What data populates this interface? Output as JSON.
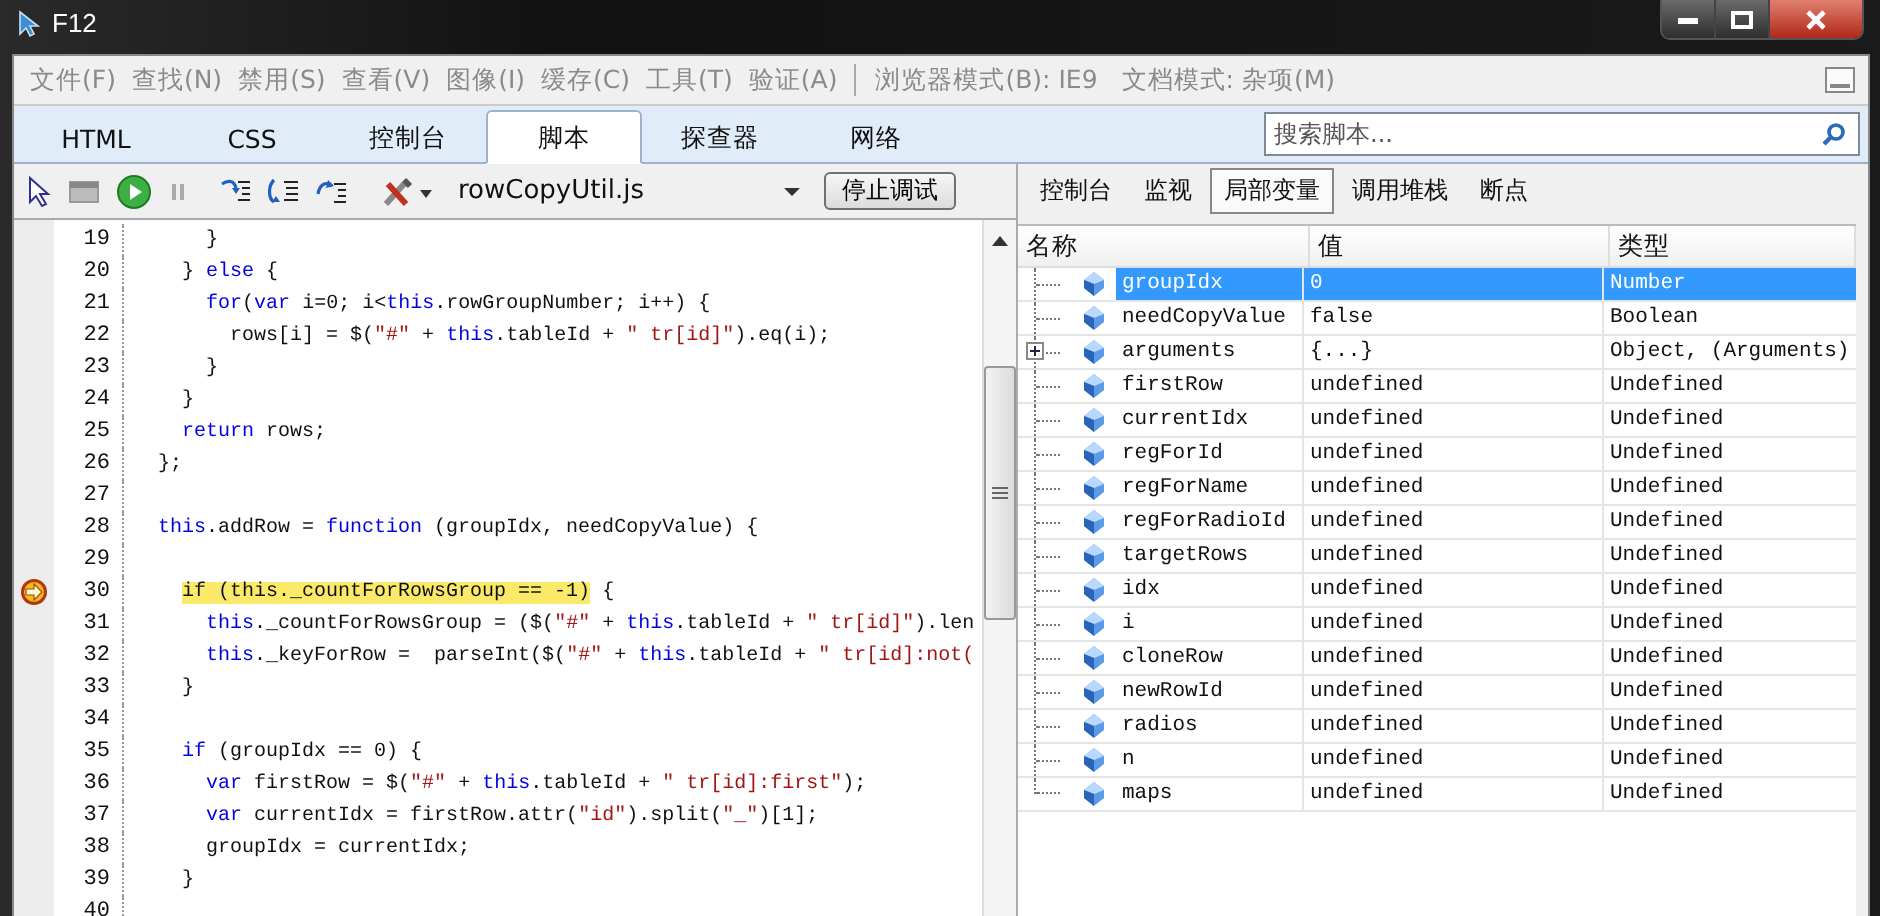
{
  "window": {
    "title": "F12"
  },
  "menu": [
    {
      "label": "文件(F)",
      "kind": "item"
    },
    {
      "label": "查找(N)",
      "kind": "item"
    },
    {
      "label": "禁用(S)",
      "kind": "item"
    },
    {
      "label": "查看(V)",
      "kind": "item"
    },
    {
      "label": "图像(I)",
      "kind": "item"
    },
    {
      "label": "缓存(C)",
      "kind": "item"
    },
    {
      "label": "工具(T)",
      "kind": "item"
    },
    {
      "label": "验证(A)",
      "kind": "item"
    },
    {
      "label": "浏览器模式(B): IE9",
      "kind": "mode"
    },
    {
      "label": "文档模式: 杂项(M)",
      "kind": "mode"
    }
  ],
  "tabs": [
    {
      "label": "HTML",
      "selected": false
    },
    {
      "label": "CSS",
      "selected": false
    },
    {
      "label": "控制台",
      "selected": false
    },
    {
      "label": "脚本",
      "selected": true
    },
    {
      "label": "探查器",
      "selected": false
    },
    {
      "label": "网络",
      "selected": false
    }
  ],
  "search": {
    "placeholder": "搜索脚本..."
  },
  "toolbar": {
    "file": "rowCopyUtil.js",
    "stop_button": "停止调试"
  },
  "code": [
    {
      "number": "19",
      "current": false,
      "tokens": [
        {
          "kind": "plain",
          "text": "    }"
        }
      ]
    },
    {
      "number": "20",
      "current": false,
      "tokens": [
        {
          "kind": "plain",
          "text": "  } "
        },
        {
          "kind": "keyword",
          "text": "else"
        },
        {
          "kind": "plain",
          "text": " {"
        }
      ]
    },
    {
      "number": "21",
      "current": false,
      "tokens": [
        {
          "kind": "keyword",
          "text": "    for"
        },
        {
          "kind": "plain",
          "text": "("
        },
        {
          "kind": "keyword",
          "text": "var"
        },
        {
          "kind": "plain",
          "text": " i=0; i<"
        },
        {
          "kind": "keyword",
          "text": "this"
        },
        {
          "kind": "plain",
          "text": ".rowGroupNumber; i++) {"
        }
      ]
    },
    {
      "number": "22",
      "current": false,
      "tokens": [
        {
          "kind": "plain",
          "text": "      rows[i] = $("
        },
        {
          "kind": "string",
          "text": "\"#\""
        },
        {
          "kind": "plain",
          "text": " + "
        },
        {
          "kind": "keyword",
          "text": "this"
        },
        {
          "kind": "plain",
          "text": ".tableId + "
        },
        {
          "kind": "string",
          "text": "\" tr[id]\""
        },
        {
          "kind": "plain",
          "text": ").eq(i);"
        }
      ]
    },
    {
      "number": "23",
      "current": false,
      "tokens": [
        {
          "kind": "plain",
          "text": "    }"
        }
      ]
    },
    {
      "number": "24",
      "current": false,
      "tokens": [
        {
          "kind": "plain",
          "text": "  }"
        }
      ]
    },
    {
      "number": "25",
      "current": false,
      "tokens": [
        {
          "kind": "keyword",
          "text": "  return"
        },
        {
          "kind": "plain",
          "text": " rows;"
        }
      ]
    },
    {
      "number": "26",
      "current": false,
      "tokens": [
        {
          "kind": "plain",
          "text": "};"
        }
      ]
    },
    {
      "number": "27",
      "current": false
    },
    {
      "number": "28",
      "current": false,
      "tokens": [
        {
          "kind": "keyword",
          "text": "this"
        },
        {
          "kind": "plain",
          "text": ".addRow = "
        },
        {
          "kind": "keyword",
          "text": "function"
        },
        {
          "kind": "plain",
          "text": " (groupIdx, needCopyValue) {"
        }
      ]
    },
    {
      "number": "29",
      "current": false
    },
    {
      "number": "30",
      "current": true,
      "tokens": [
        {
          "kind": "highlight",
          "text": "  if (this._countForRowsGroup == -1)"
        },
        {
          "kind": "plain",
          "text": " {"
        }
      ]
    },
    {
      "number": "31",
      "current": false,
      "tokens": [
        {
          "kind": "keyword",
          "text": "    this"
        },
        {
          "kind": "plain",
          "text": "._countForRowsGroup = ($("
        },
        {
          "kind": "string",
          "text": "\"#\""
        },
        {
          "kind": "plain",
          "text": " + "
        },
        {
          "kind": "keyword",
          "text": "this"
        },
        {
          "kind": "plain",
          "text": ".tableId + "
        },
        {
          "kind": "string",
          "text": "\" tr[id]\""
        },
        {
          "kind": "plain",
          "text": ").len"
        }
      ]
    },
    {
      "number": "32",
      "current": false,
      "tokens": [
        {
          "kind": "keyword",
          "text": "    this"
        },
        {
          "kind": "plain",
          "text": "._keyForRow =  parseInt($("
        },
        {
          "kind": "string",
          "text": "\"#\""
        },
        {
          "kind": "plain",
          "text": " + "
        },
        {
          "kind": "keyword",
          "text": "this"
        },
        {
          "kind": "plain",
          "text": ".tableId + "
        },
        {
          "kind": "string",
          "text": "\" tr[id]:not("
        }
      ]
    },
    {
      "number": "33",
      "current": false,
      "tokens": [
        {
          "kind": "plain",
          "text": "  }"
        }
      ]
    },
    {
      "number": "34",
      "current": false
    },
    {
      "number": "35",
      "current": false,
      "tokens": [
        {
          "kind": "keyword",
          "text": "  if"
        },
        {
          "kind": "plain",
          "text": " (groupIdx == 0) {"
        }
      ]
    },
    {
      "number": "36",
      "current": false,
      "tokens": [
        {
          "kind": "keyword",
          "text": "    var"
        },
        {
          "kind": "plain",
          "text": " firstRow = $("
        },
        {
          "kind": "string",
          "text": "\"#\""
        },
        {
          "kind": "plain",
          "text": " + "
        },
        {
          "kind": "keyword",
          "text": "this"
        },
        {
          "kind": "plain",
          "text": ".tableId + "
        },
        {
          "kind": "string",
          "text": "\" tr[id]:first\""
        },
        {
          "kind": "plain",
          "text": ");"
        }
      ]
    },
    {
      "number": "37",
      "current": false,
      "tokens": [
        {
          "kind": "keyword",
          "text": "    var"
        },
        {
          "kind": "plain",
          "text": " currentIdx = firstRow.attr("
        },
        {
          "kind": "string",
          "text": "\"id\""
        },
        {
          "kind": "plain",
          "text": ").split("
        },
        {
          "kind": "string",
          "text": "\"_\""
        },
        {
          "kind": "plain",
          "text": ")[1];"
        }
      ]
    },
    {
      "number": "38",
      "current": false,
      "tokens": [
        {
          "kind": "plain",
          "text": "    groupIdx = currentIdx;"
        }
      ]
    },
    {
      "number": "39",
      "current": false,
      "tokens": [
        {
          "kind": "plain",
          "text": "  }"
        }
      ]
    },
    {
      "number": "40",
      "current": false
    }
  ],
  "side_tabs": [
    {
      "label": "控制台",
      "selected": false
    },
    {
      "label": "监视",
      "selected": false
    },
    {
      "label": "局部变量",
      "selected": true
    },
    {
      "label": "调用堆栈",
      "selected": false
    },
    {
      "label": "断点",
      "selected": false
    }
  ],
  "locals": {
    "columns": [
      "名称",
      "值",
      "类型"
    ],
    "rows": [
      {
        "name": "groupIdx",
        "value": "0",
        "type": "Number",
        "selected": true,
        "kind": "value"
      },
      {
        "name": "needCopyValue",
        "value": "false",
        "type": "Boolean",
        "selected": false,
        "kind": "value"
      },
      {
        "name": "arguments",
        "value": "{...}",
        "type": "Object, (Arguments)",
        "selected": false,
        "kind": "object",
        "expanded": false
      },
      {
        "name": "firstRow",
        "value": "undefined",
        "type": "Undefined",
        "selected": false,
        "kind": "value"
      },
      {
        "name": "currentIdx",
        "value": "undefined",
        "type": "Undefined",
        "selected": false,
        "kind": "value"
      },
      {
        "name": "regForId",
        "value": "undefined",
        "type": "Undefined",
        "selected": false,
        "kind": "value"
      },
      {
        "name": "regForName",
        "value": "undefined",
        "type": "Undefined",
        "selected": false,
        "kind": "value"
      },
      {
        "name": "regForRadioId",
        "value": "undefined",
        "type": "Undefined",
        "selected": false,
        "kind": "value"
      },
      {
        "name": "targetRows",
        "value": "undefined",
        "type": "Undefined",
        "selected": false,
        "kind": "value"
      },
      {
        "name": "idx",
        "value": "undefined",
        "type": "Undefined",
        "selected": false,
        "kind": "value"
      },
      {
        "name": "i",
        "value": "undefined",
        "type": "Undefined",
        "selected": false,
        "kind": "value"
      },
      {
        "name": "cloneRow",
        "value": "undefined",
        "type": "Undefined",
        "selected": false,
        "kind": "value"
      },
      {
        "name": "newRowId",
        "value": "undefined",
        "type": "Undefined",
        "selected": false,
        "kind": "value"
      },
      {
        "name": "radios",
        "value": "undefined",
        "type": "Undefined",
        "selected": false,
        "kind": "value"
      },
      {
        "name": "n",
        "value": "undefined",
        "type": "Undefined",
        "selected": false,
        "kind": "value"
      },
      {
        "name": "maps",
        "value": "undefined",
        "type": "Undefined",
        "selected": false,
        "kind": "value"
      }
    ]
  }
}
